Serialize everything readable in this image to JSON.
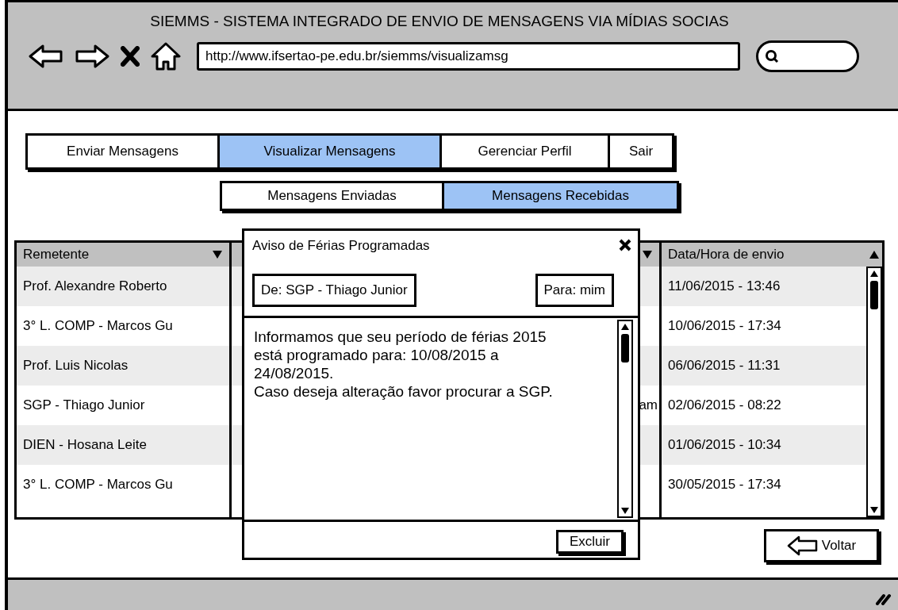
{
  "window": {
    "title": "SIEMMS - SISTEMA INTEGRADO DE ENVIO DE MENSAGENS VIA MÍDIAS SOCIAS",
    "url": "http://www.ifsertao-pe.edu.br/siemms/visualizamsg"
  },
  "tabs": [
    {
      "label": "Enviar Mensagens",
      "selected": false
    },
    {
      "label": "Visualizar Mensagens",
      "selected": true
    },
    {
      "label": "Gerenciar Perfil",
      "selected": false
    },
    {
      "label": "Sair",
      "selected": false
    }
  ],
  "subtabs": [
    {
      "label": "Mensagens Enviadas",
      "selected": false
    },
    {
      "label": "Mensagens Recebidas",
      "selected": true
    }
  ],
  "table": {
    "columns": [
      "Remetente",
      "Data/Hora de envio"
    ],
    "rows": [
      {
        "sender": "Prof. Alexandre Roberto",
        "sent_at": "11/06/2015 - 13:46"
      },
      {
        "sender": "3° L. COMP - Marcos Gu",
        "sent_at": "10/06/2015 - 17:34"
      },
      {
        "sender": "Prof. Luis Nicolas",
        "sent_at": "06/06/2015 - 11:31"
      },
      {
        "sender": "SGP - Thiago Junior",
        "column_2": "am",
        "sent_at": "02/06/2015 - 08:22"
      },
      {
        "sender": "DIEN - Hosana Leite",
        "sent_at": "01/06/2015 - 10:34"
      },
      {
        "sender": "3° L. COMP - Marcos Gu",
        "sent_at": "30/05/2015 - 17:34"
      }
    ]
  },
  "dialog": {
    "title": "Aviso de Férias Programadas",
    "from": "De: SGP - Thiago Junior",
    "to": "Para: mim",
    "body": [
      "Informamos que seu período de férias 2015 está programado para: 10/08/2015 a 24/08/2015.",
      "Caso deseja alteração favor procurar a SGP."
    ],
    "delete_button": "Excluir"
  },
  "back_button": "Voltar"
}
